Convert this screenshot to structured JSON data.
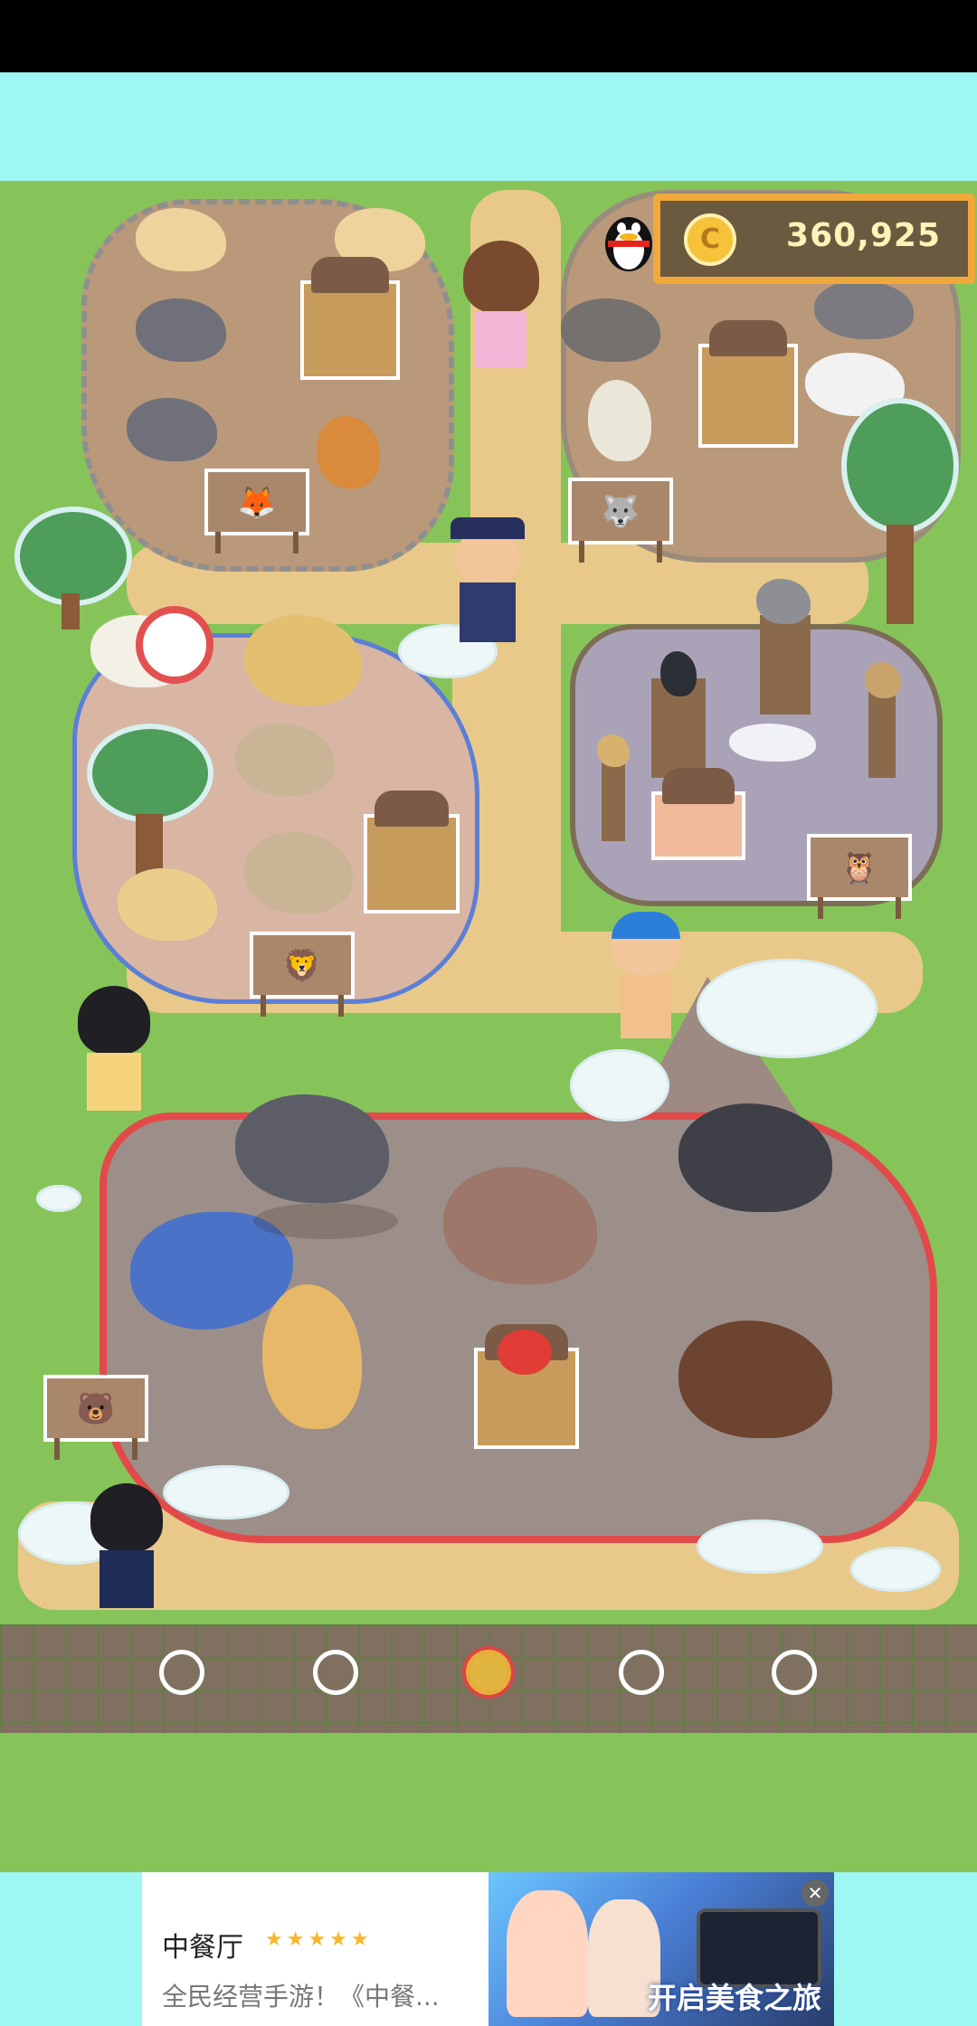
{
  "hud": {
    "coin_icon_label": "C",
    "coin_amount": "360,925",
    "qq_icon": "qq-penguin-icon"
  },
  "signs": {
    "fox_pen": "fox-sign-icon",
    "wolf_pen": "wolf-sign-icon",
    "lion_pen": "lion-sign-icon",
    "owl_pen": "owl-sign-icon",
    "bear_pen": "bear-sign-icon"
  },
  "pagination": {
    "count": 5,
    "active_index": 2
  },
  "ad": {
    "title": "中餐厅",
    "stars": "★★★★★",
    "description": "全民经营手游！《中餐...",
    "image_caption": "开启美食之旅",
    "close_icon": "close-icon",
    "close_glyph": "✕"
  },
  "colors": {
    "grass": "#86c45a",
    "sky": "#9ff7f4",
    "path": "#e9c98a",
    "bear_fence": "#e24a4a",
    "lion_fence": "#5c7fd6",
    "coin": "#f6c23a"
  }
}
